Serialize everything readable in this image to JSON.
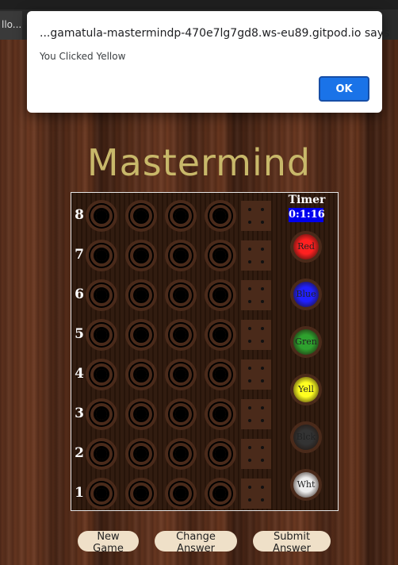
{
  "browser": {
    "tab_text": "llo..."
  },
  "alert": {
    "title": "...gamatula-mastermindp-470e7lg7gd8.ws-eu89.gitpod.io says",
    "message": "You Clicked Yellow",
    "ok_label": "OK"
  },
  "game": {
    "title": "Mastermind",
    "rows": [
      "8",
      "7",
      "6",
      "5",
      "4",
      "3",
      "2",
      "1"
    ],
    "timer_label": "Timer",
    "timer_value": "0:1:16",
    "colors": [
      {
        "label": "Red",
        "color": "#ff2020"
      },
      {
        "label": "Blue",
        "color": "#2020ff"
      },
      {
        "label": "Gren",
        "color": "#2ea12e"
      },
      {
        "label": "Yell",
        "color": "#ffff20"
      },
      {
        "label": "Blck",
        "color": "#333333"
      },
      {
        "label": "Wht",
        "color": "#eeeeee"
      }
    ]
  },
  "buttons": {
    "new_game": "New Game",
    "change_answer": "Change Answer",
    "submit_answer": "Submit Answer"
  }
}
